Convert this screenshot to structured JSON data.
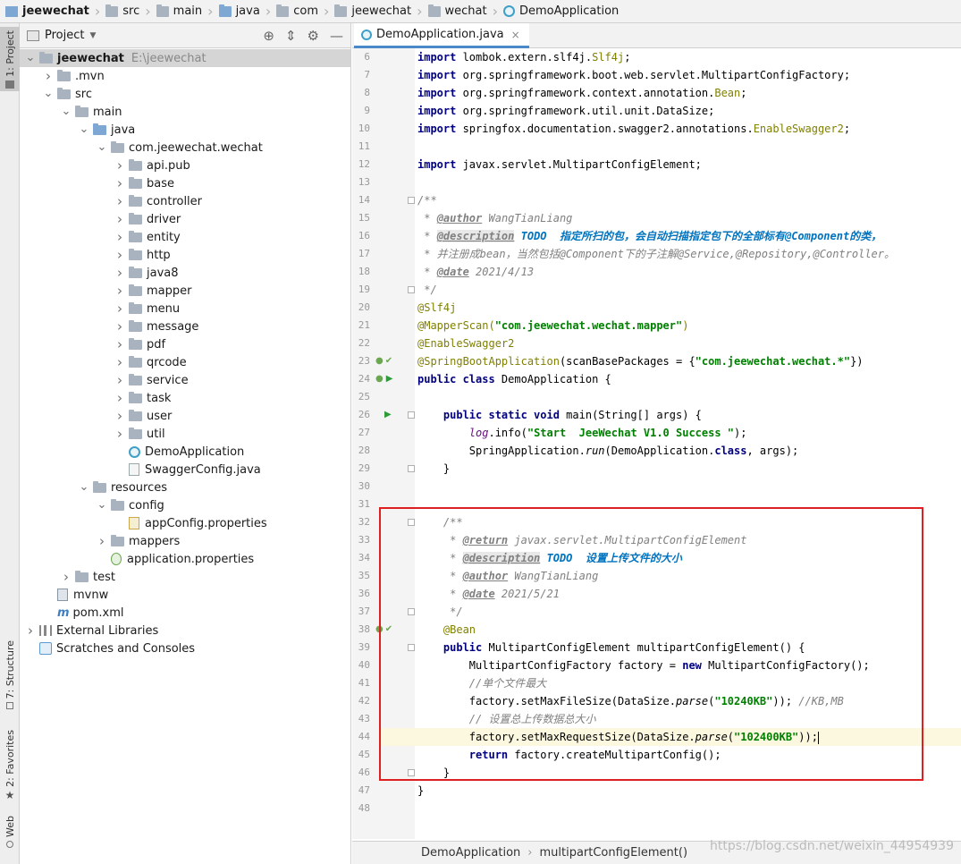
{
  "breadcrumb": [
    {
      "label": "jeewechat",
      "icon": "project-icon"
    },
    {
      "label": "src",
      "icon": "folder-icon"
    },
    {
      "label": "main",
      "icon": "folder-icon"
    },
    {
      "label": "java",
      "icon": "source-folder-icon"
    },
    {
      "label": "com",
      "icon": "package-icon"
    },
    {
      "label": "jeewechat",
      "icon": "package-icon"
    },
    {
      "label": "wechat",
      "icon": "package-icon"
    },
    {
      "label": "DemoApplication",
      "icon": "class-icon"
    }
  ],
  "left_strip": {
    "project_label": "1: Project",
    "structure_label": "7: Structure",
    "favorites_label": "2: Favorites",
    "web_label": "Web"
  },
  "project_panel": {
    "title": "Project",
    "tree": [
      {
        "label": "jeewechat",
        "extra": "E:\\jeewechat",
        "depth": 0,
        "arrow": "down",
        "icon": "folder"
      },
      {
        "label": ".mvn",
        "depth": 1,
        "arrow": "right",
        "icon": "folder"
      },
      {
        "label": "src",
        "depth": 1,
        "arrow": "down",
        "icon": "folder"
      },
      {
        "label": "main",
        "depth": 2,
        "arrow": "down",
        "icon": "folder"
      },
      {
        "label": "java",
        "depth": 3,
        "arrow": "down",
        "icon": "folder-blue"
      },
      {
        "label": "com.jeewechat.wechat",
        "depth": 4,
        "arrow": "down",
        "icon": "package"
      },
      {
        "label": "api.pub",
        "depth": 5,
        "arrow": "right",
        "icon": "package"
      },
      {
        "label": "base",
        "depth": 5,
        "arrow": "right",
        "icon": "package"
      },
      {
        "label": "controller",
        "depth": 5,
        "arrow": "right",
        "icon": "package"
      },
      {
        "label": "driver",
        "depth": 5,
        "arrow": "right",
        "icon": "package"
      },
      {
        "label": "entity",
        "depth": 5,
        "arrow": "right",
        "icon": "package"
      },
      {
        "label": "http",
        "depth": 5,
        "arrow": "right",
        "icon": "package"
      },
      {
        "label": "java8",
        "depth": 5,
        "arrow": "right",
        "icon": "package"
      },
      {
        "label": "mapper",
        "depth": 5,
        "arrow": "right",
        "icon": "package"
      },
      {
        "label": "menu",
        "depth": 5,
        "arrow": "right",
        "icon": "package"
      },
      {
        "label": "message",
        "depth": 5,
        "arrow": "right",
        "icon": "package"
      },
      {
        "label": "pdf",
        "depth": 5,
        "arrow": "right",
        "icon": "package"
      },
      {
        "label": "qrcode",
        "depth": 5,
        "arrow": "right",
        "icon": "package"
      },
      {
        "label": "service",
        "depth": 5,
        "arrow": "right",
        "icon": "package"
      },
      {
        "label": "task",
        "depth": 5,
        "arrow": "right",
        "icon": "package"
      },
      {
        "label": "user",
        "depth": 5,
        "arrow": "right",
        "icon": "package"
      },
      {
        "label": "util",
        "depth": 5,
        "arrow": "right",
        "icon": "package"
      },
      {
        "label": "DemoApplication",
        "depth": 5,
        "arrow": "none",
        "icon": "class"
      },
      {
        "label": "SwaggerConfig.java",
        "depth": 5,
        "arrow": "none",
        "icon": "java-file"
      },
      {
        "label": "resources",
        "depth": 3,
        "arrow": "down",
        "icon": "folder"
      },
      {
        "label": "config",
        "depth": 4,
        "arrow": "down",
        "icon": "folder"
      },
      {
        "label": "appConfig.properties",
        "depth": 5,
        "arrow": "none",
        "icon": "properties"
      },
      {
        "label": "mappers",
        "depth": 4,
        "arrow": "right",
        "icon": "folder"
      },
      {
        "label": "application.properties",
        "depth": 4,
        "arrow": "none",
        "icon": "spring-properties"
      },
      {
        "label": "test",
        "depth": 2,
        "arrow": "right",
        "icon": "folder"
      },
      {
        "label": "mvnw",
        "depth": 1,
        "arrow": "none",
        "icon": "mvnw"
      },
      {
        "label": "pom.xml",
        "depth": 1,
        "arrow": "none",
        "icon": "maven"
      },
      {
        "label": "External Libraries",
        "depth": 0,
        "arrow": "right",
        "icon": "library"
      },
      {
        "label": "Scratches and Consoles",
        "depth": 0,
        "arrow": "none",
        "icon": "scratches"
      }
    ]
  },
  "editor": {
    "tab_label": "DemoApplication.java",
    "line_numbers": [
      "6",
      "7",
      "8",
      "9",
      "10",
      "11",
      "12",
      "13",
      "14",
      "15",
      "16",
      "17",
      "18",
      "19",
      "20",
      "21",
      "22",
      "23",
      "24",
      "25",
      "26",
      "27",
      "28",
      "29",
      "30",
      "31",
      "32",
      "33",
      "34",
      "35",
      "36",
      "37",
      "38",
      "39",
      "40",
      "41",
      "42",
      "43",
      "44",
      "45",
      "46",
      "47",
      "48"
    ],
    "code": {
      "l6": {
        "kw": "import",
        "rest": " lombok.extern.slf4j.",
        "ann": "Slf4j",
        "end": ";"
      },
      "l7": {
        "kw": "import",
        "rest": " org.springframework.boot.web.servlet.MultipartConfigFactory;"
      },
      "l8": {
        "kw": "import",
        "rest": " org.springframework.context.annotation.",
        "ann": "Bean",
        "end": ";"
      },
      "l9": {
        "kw": "import",
        "rest": " org.springframework.util.unit.DataSize;"
      },
      "l10": {
        "kw": "import",
        "rest": " springfox.documentation.swagger2.annotations.",
        "ann": "EnableSwagger2",
        "end": ";"
      },
      "l12": {
        "kw": "import",
        "rest": " javax.servlet.MultipartConfigElement;"
      },
      "l14": "/**",
      "l15": {
        "pre": " * ",
        "tag": "@author",
        "rest": " WangTianLiang"
      },
      "l16": {
        "pre": " * ",
        "tag": "@description",
        "todo": " TODO  指定所扫的包，会自动扫描指定包下的全部标有@Component的类，"
      },
      "l17": " * 并注册成bean，当然包括@Component下的子注解@Service,@Repository,@Controller。",
      "l18": {
        "pre": " * ",
        "tag": "@date",
        "rest": " 2021/4/13"
      },
      "l19": " */",
      "l20": "@Slf4j",
      "l21": {
        "ann": "@MapperScan(",
        "str": "\"com.jeewechat.wechat.mapper\"",
        "end": ")"
      },
      "l22": "@EnableSwagger2",
      "l23": {
        "ann": "@SpringBootApplication",
        "rest": "(scanBasePackages = {",
        "str": "\"com.jeewechat.wechat.*\"",
        "end": "})"
      },
      "l24": {
        "kw": "public class",
        "rest": " DemoApplication {"
      },
      "l26": {
        "indent": "    ",
        "kw": "public static void",
        "rest": " main(String[] args) {"
      },
      "l27": {
        "indent": "        ",
        "fld": "log",
        "rest": ".info(",
        "str": "\"Start  JeeWechat V1.0 Success \"",
        "end": ");"
      },
      "l28": {
        "indent": "        ",
        "pre": "SpringApplication.",
        "stat": "run",
        "rest": "(DemoApplication.",
        "kw": "class",
        "end": ", args);"
      },
      "l29": "    }",
      "l32": "    /**",
      "l33": {
        "pre": "     * ",
        "tag": "@return",
        "rest": " javax.servlet.MultipartConfigElement"
      },
      "l34": {
        "pre": "     * ",
        "tag": "@description",
        "todo": " TODO  设置上传文件的大小"
      },
      "l35": {
        "pre": "     * ",
        "tag": "@author",
        "rest": " WangTianLiang"
      },
      "l36": {
        "pre": "     * ",
        "tag": "@date",
        "rest": " 2021/5/21"
      },
      "l37": "     */",
      "l38": "    @Bean",
      "l39": {
        "indent": "    ",
        "kw": "public",
        "rest": " MultipartConfigElement multipartConfigElement() {"
      },
      "l40": {
        "indent": "        ",
        "pre": "MultipartConfigFactory factory = ",
        "kw": "new",
        "rest": " MultipartConfigFactory();"
      },
      "l41": "        //单个文件最大",
      "l42": {
        "indent": "        ",
        "pre": "factory.setMaxFileSize(DataSize.",
        "stat": "parse",
        "rest": "(",
        "str": "\"10240KB\"",
        "end": "));",
        "cmt": " //KB,MB"
      },
      "l43": "        // 设置总上传数据总大小",
      "l44": {
        "indent": "        ",
        "pre": "factory.setMaxRequestSize(DataSize.",
        "stat": "parse",
        "rest": "(",
        "str": "\"102400KB\"",
        "end": "));"
      },
      "l45": {
        "indent": "        ",
        "kw": "return",
        "rest": " factory.createMultipartConfig();"
      },
      "l46": "    }",
      "l47": "}"
    }
  },
  "status_bar": {
    "crumb1": "DemoApplication",
    "crumb2": "multipartConfigElement()"
  },
  "watermark": "https://blog.csdn.net/weixin_44954939",
  "colors": {
    "keyword": "#000080",
    "annotation": "#808000",
    "string": "#008000",
    "comment": "#808080",
    "todo": "#0073bf",
    "highlight_box": "#e02020",
    "current_line": "#fcf8e0"
  }
}
